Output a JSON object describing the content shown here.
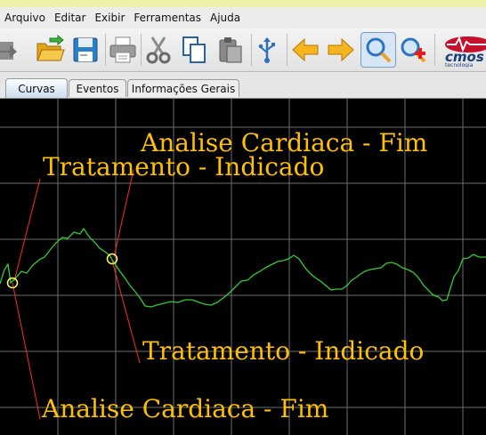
{
  "menu": [
    "Arquivo",
    "Editar",
    "Exibir",
    "Ferramentas",
    "Ajuda"
  ],
  "toolbar": {
    "buttons": [
      {
        "name": "open-button",
        "icon": "open-folder-icon"
      },
      {
        "name": "save-button",
        "icon": "floppy-disk-icon"
      },
      {
        "name": "print-button",
        "icon": "printer-icon"
      },
      {
        "name": "cut-button",
        "icon": "scissors-icon"
      },
      {
        "name": "copy-button",
        "icon": "copy-icon"
      },
      {
        "name": "paste-button",
        "icon": "clipboard-icon"
      },
      {
        "name": "usb-button",
        "icon": "usb-icon"
      },
      {
        "name": "previous-button",
        "icon": "arrow-left-icon"
      },
      {
        "name": "next-button",
        "icon": "arrow-right-icon"
      },
      {
        "name": "zoom-button",
        "icon": "magnifier-icon"
      },
      {
        "name": "zoom-in-button",
        "icon": "magnifier-plus-icon"
      }
    ],
    "logo_text": "cmos",
    "logo_subtext": "tecnologia"
  },
  "tabs": [
    {
      "label": "Curvas",
      "active": true
    },
    {
      "label": "Eventos",
      "active": false
    },
    {
      "label": "Informações Gerais",
      "active": false
    }
  ],
  "annotations": {
    "top_fim": "Analise Cardiaca - Fim",
    "top_indicado": "Tratamento - Indicado",
    "bottom_indicado": "Tratamento - Indicado",
    "bottom_fim": "Analise Cardiaca - Fim"
  },
  "colors": {
    "background": "#000000",
    "grid": "#6e6e6e",
    "curve": "#33cc33",
    "marker": "#ffff66",
    "leader": "#ff2a2a",
    "annotation": "#ffc000"
  }
}
